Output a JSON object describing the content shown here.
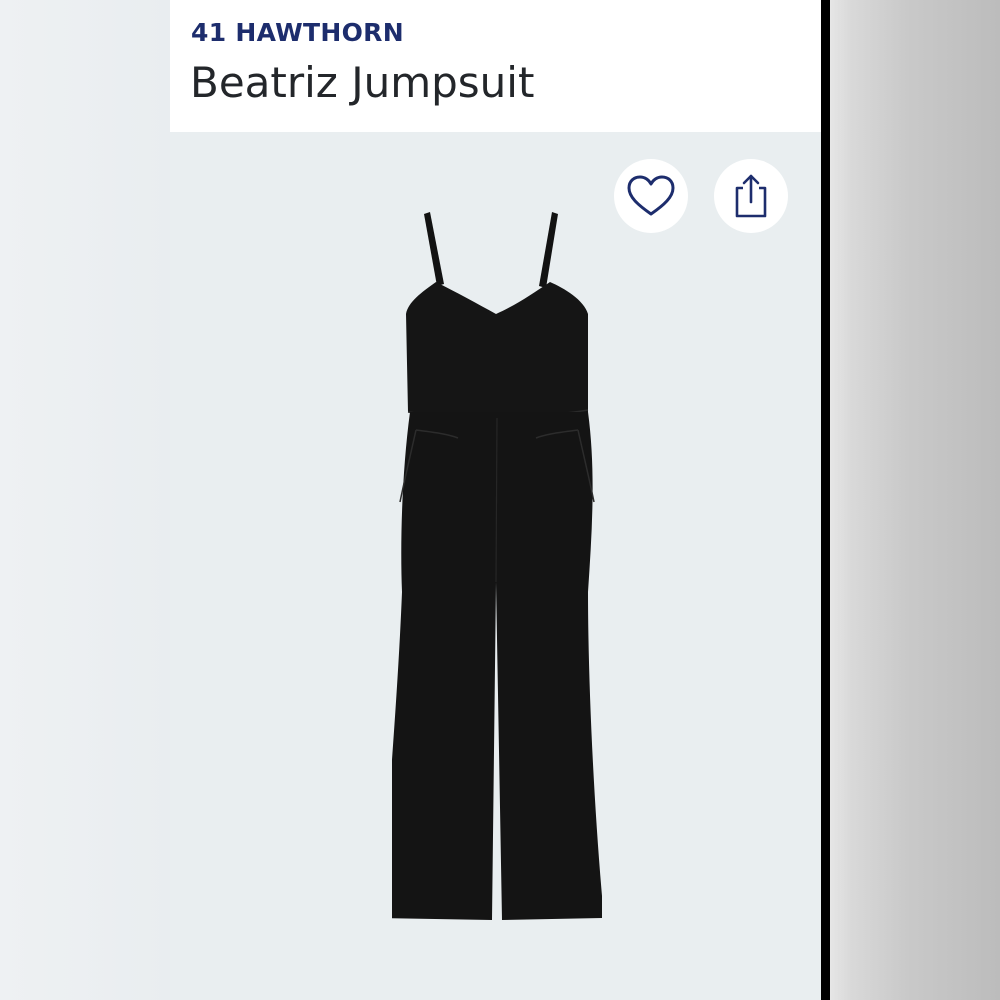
{
  "product": {
    "brand": "41 HAWTHORN",
    "title": "Beatriz Jumpsuit"
  },
  "actions": {
    "favorite_icon": "heart-icon",
    "share_icon": "share-icon"
  },
  "colors": {
    "brand_text": "#1d2d6d",
    "title_text": "#23262a",
    "image_background": "#e9eef0",
    "garment": "#121212"
  }
}
